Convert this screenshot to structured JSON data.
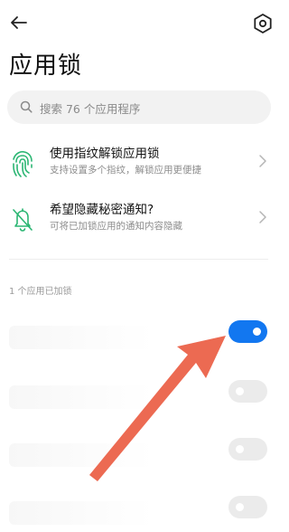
{
  "header": {
    "title": "应用锁",
    "back_icon": "back-arrow-icon",
    "settings_icon": "gear-icon"
  },
  "search": {
    "placeholder": "搜索 76 个应用程序",
    "icon": "search-icon"
  },
  "options": [
    {
      "title": "使用指纹解锁应用锁",
      "subtitle": "支持设置多个指纹，解锁应用更便捷",
      "icon": "fingerprint-icon"
    },
    {
      "title": "希望隐藏秘密通知?",
      "subtitle": "可将已加锁应用的通知内容隐藏",
      "icon": "bell-off-icon"
    }
  ],
  "section_label": "1 个应用已加锁",
  "apps": [
    {
      "locked": true
    },
    {
      "locked": false
    },
    {
      "locked": false
    },
    {
      "locked": false
    }
  ],
  "colors": {
    "accent": "#1277f0",
    "icon_green": "#2bb673",
    "annotation_arrow": "#ec6a52"
  }
}
